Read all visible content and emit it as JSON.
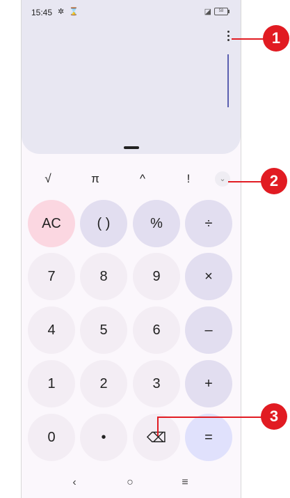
{
  "status_bar": {
    "time": "15:45",
    "icons": [
      "gear-icon",
      "hourglass-icon"
    ],
    "right_icons": [
      "no-sim-icon",
      "battery-icon"
    ],
    "battery_text": "58"
  },
  "display": {
    "menu_icon": "more-vertical-icon",
    "expression": "",
    "result": ""
  },
  "scientific_row": [
    {
      "label": "√",
      "name": "sqrt"
    },
    {
      "label": "π",
      "name": "pi"
    },
    {
      "label": "^",
      "name": "power"
    },
    {
      "label": "!",
      "name": "factorial"
    }
  ],
  "expand_icon": "chevron-down-icon",
  "keypad": [
    [
      {
        "label": "AC",
        "kind": "ac",
        "name": "ac"
      },
      {
        "label": "( )",
        "kind": "fn",
        "name": "parentheses"
      },
      {
        "label": "%",
        "kind": "fn",
        "name": "percent"
      },
      {
        "label": "÷",
        "kind": "op",
        "name": "divide"
      }
    ],
    [
      {
        "label": "7",
        "kind": "num",
        "name": "7"
      },
      {
        "label": "8",
        "kind": "num",
        "name": "8"
      },
      {
        "label": "9",
        "kind": "num",
        "name": "9"
      },
      {
        "label": "×",
        "kind": "op",
        "name": "multiply"
      }
    ],
    [
      {
        "label": "4",
        "kind": "num",
        "name": "4"
      },
      {
        "label": "5",
        "kind": "num",
        "name": "5"
      },
      {
        "label": "6",
        "kind": "num",
        "name": "6"
      },
      {
        "label": "–",
        "kind": "op",
        "name": "subtract"
      }
    ],
    [
      {
        "label": "1",
        "kind": "num",
        "name": "1"
      },
      {
        "label": "2",
        "kind": "num",
        "name": "2"
      },
      {
        "label": "3",
        "kind": "num",
        "name": "3"
      },
      {
        "label": "+",
        "kind": "op",
        "name": "add"
      }
    ],
    [
      {
        "label": "0",
        "kind": "num",
        "name": "0"
      },
      {
        "label": "•",
        "kind": "num",
        "name": "decimal"
      },
      {
        "label": "⌫",
        "kind": "num",
        "name": "backspace"
      },
      {
        "label": "=",
        "kind": "eq",
        "name": "equals"
      }
    ]
  ],
  "nav_bar": {
    "back": "‹",
    "home": "○",
    "recents": "≡"
  },
  "callouts": {
    "c1": "1",
    "c2": "2",
    "c3": "3"
  },
  "colors": {
    "callout": "#e11b22",
    "display_bg": "#e8e7f2",
    "ac_key": "#fbd7e1",
    "equals_key": "#e0e1fc"
  }
}
